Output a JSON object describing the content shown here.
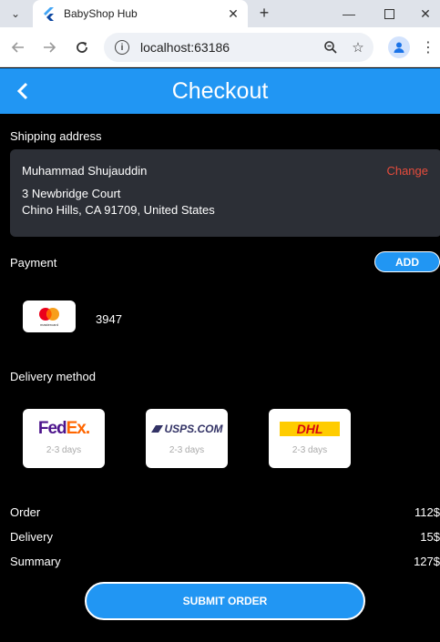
{
  "browser": {
    "tab_title": "BabyShop Hub",
    "url": "localhost:63186",
    "icons": [
      "tab-dropdown-icon",
      "flutter-favicon",
      "close-icon",
      "plus-icon",
      "minimize-icon",
      "maximize-icon",
      "close-window-icon",
      "back-arrow-icon",
      "forward-arrow-icon",
      "reload-icon",
      "info-icon",
      "zoom-icon",
      "star-icon",
      "profile-icon",
      "more-vert-icon"
    ]
  },
  "app": {
    "title": "Checkout",
    "accent": "#2196f3",
    "shipping": {
      "label": "Shipping address",
      "name": "Muhammad Shujauddin",
      "change_label": "Change",
      "change_color": "#e74c3c",
      "line1": "3 Newbridge Court",
      "line2": "Chino Hills, CA 91709, United States"
    },
    "payment": {
      "label": "Payment",
      "add_label": "ADD",
      "card_logo": "mastercard",
      "card_logo_text": "mastercard",
      "card_number": "3947"
    },
    "delivery": {
      "label": "Delivery method",
      "options": [
        {
          "logo": "FedEx.",
          "days": "2-3 days"
        },
        {
          "logo": "USPS.COM",
          "days": "2-3 days"
        },
        {
          "logo": "DHL",
          "days": "2-3 days"
        }
      ]
    },
    "summary": {
      "order_label": "Order",
      "order_value": "112$",
      "delivery_label": "Delivery",
      "delivery_value": "15$",
      "summary_label": "Summary",
      "summary_value": "127$"
    },
    "submit_label": "SUBMIT ORDER"
  }
}
